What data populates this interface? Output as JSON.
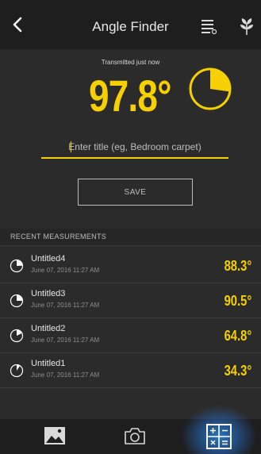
{
  "header": {
    "title": "Angle Finder",
    "icons": [
      "chevron-left-icon",
      "list-icon",
      "plant-icon"
    ]
  },
  "status": "Transmitted just now",
  "reading": {
    "value": "97.8°",
    "fraction": 0.272
  },
  "title_input": {
    "placeholder": "Enter title (eg, Bedroom carpet)",
    "value": ""
  },
  "save_label": "SAVE",
  "recent": {
    "header": "RECENT MEASUREMENTS",
    "items": [
      {
        "name": "Untitled4",
        "date": "June 07, 2016 11:27 AM",
        "value": "88.3°",
        "fraction": 0.245
      },
      {
        "name": "Untitled3",
        "date": "June 07, 2016 11:27 AM",
        "value": "90.5°",
        "fraction": 0.251
      },
      {
        "name": "Untitled2",
        "date": "June 07, 2016 11:27 AM",
        "value": "64.8°",
        "fraction": 0.18
      },
      {
        "name": "Untitled1",
        "date": "June 07, 2016 11:27 AM",
        "value": "34.3°",
        "fraction": 0.095
      }
    ]
  },
  "tabs": [
    {
      "name": "gallery-icon",
      "active": false
    },
    {
      "name": "camera-icon",
      "active": false
    },
    {
      "name": "calculator-icon",
      "active": true
    }
  ],
  "colors": {
    "accent": "#f6d000",
    "background": "#2b2b2b",
    "bar": "#1e1e1e",
    "active_tab_glow": "#2b82dc"
  }
}
